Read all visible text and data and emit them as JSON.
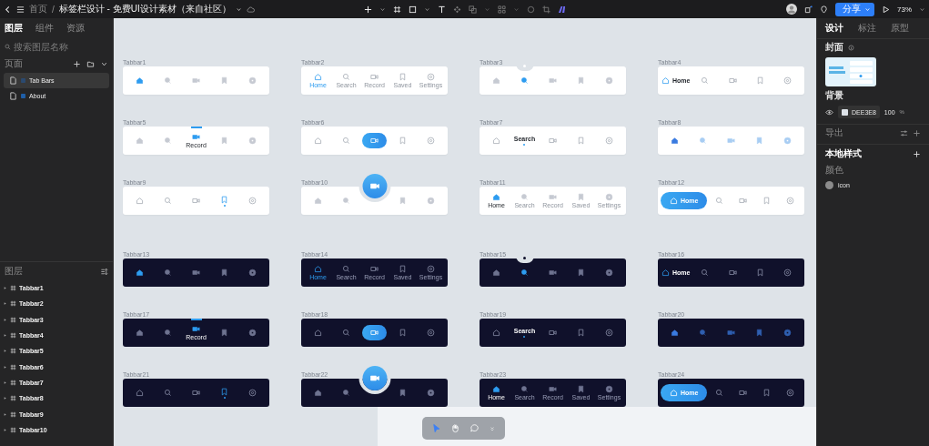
{
  "topbar": {
    "breadcrumb": "首页",
    "separator": "/",
    "title": "标签栏设计 - 免费UI设计素材（来自社区）",
    "share": "分享",
    "zoom": "73%"
  },
  "left_panel": {
    "tabs": [
      {
        "label": "图层",
        "selected": true
      },
      {
        "label": "组件",
        "selected": false
      },
      {
        "label": "资源",
        "selected": false
      }
    ],
    "search": {
      "placeholder": "搜索图层名称"
    },
    "pages_header": "页面",
    "pages": [
      {
        "name": "Tab Bars",
        "selected": true
      },
      {
        "name": "About",
        "selected": false
      }
    ],
    "layers_header": "图层",
    "layers": [
      {
        "name": "Tabbar1"
      },
      {
        "name": "Tabbar2"
      },
      {
        "name": "Tabbar3"
      },
      {
        "name": "Tabbar4"
      },
      {
        "name": "Tabbar5"
      },
      {
        "name": "Tabbar6"
      },
      {
        "name": "Tabbar7"
      },
      {
        "name": "Tabbar8"
      },
      {
        "name": "Tabbar9"
      },
      {
        "name": "Tabbar10"
      }
    ]
  },
  "canvas": {
    "tabbars": [
      {
        "title": "Tabbar1",
        "dark": false,
        "kind": "plain",
        "outline_icons": false,
        "items": [
          {
            "selected": true
          },
          {
            "selected": false
          },
          {
            "selected": false
          },
          {
            "selected": false
          },
          {
            "selected": false
          }
        ]
      },
      {
        "title": "Tabbar2",
        "dark": false,
        "kind": "labeled",
        "outline_icons": true,
        "items": [
          {
            "label": "Home",
            "selected": true
          },
          {
            "label": "Search",
            "selected": false
          },
          {
            "label": "Record",
            "selected": false
          },
          {
            "label": "Saved",
            "selected": false
          },
          {
            "label": "Settings",
            "selected": false
          }
        ]
      },
      {
        "title": "Tabbar3",
        "dark": false,
        "kind": "notch",
        "outline_icons": false,
        "items": [
          {
            "selected": false
          },
          {
            "selected": true
          },
          {
            "selected": false
          },
          {
            "selected": false
          },
          {
            "selected": false
          }
        ]
      },
      {
        "title": "Tabbar4",
        "dark": false,
        "kind": "inline-label",
        "outline_icons": true,
        "items": [
          {
            "label": "Home",
            "selected": true
          },
          {
            "selected": false
          },
          {
            "selected": false
          },
          {
            "selected": false
          },
          {
            "selected": false
          }
        ]
      },
      {
        "title": "Tabbar5",
        "dark": false,
        "kind": "top-bar",
        "outline_icons": false,
        "items": [
          {
            "selected": false
          },
          {
            "selected": false
          },
          {
            "label": "Record",
            "selected": true
          },
          {
            "selected": false
          },
          {
            "selected": false
          }
        ]
      },
      {
        "title": "Tabbar6",
        "dark": false,
        "kind": "pill-icon",
        "outline_icons": true,
        "items": [
          {
            "selected": false
          },
          {
            "selected": false
          },
          {
            "selected": true
          },
          {
            "selected": false
          },
          {
            "selected": false
          }
        ]
      },
      {
        "title": "Tabbar7",
        "dark": false,
        "kind": "text-dot",
        "outline_icons": true,
        "items": [
          {
            "selected": false
          },
          {
            "label": "Search",
            "selected": true
          },
          {
            "selected": false
          },
          {
            "selected": false
          },
          {
            "selected": false
          }
        ]
      },
      {
        "title": "Tabbar8",
        "dark": false,
        "kind": "gradient",
        "outline_icons": false,
        "items": [
          {
            "selected": true
          },
          {
            "selected": false
          },
          {
            "selected": false
          },
          {
            "selected": false
          },
          {
            "selected": false
          }
        ]
      },
      {
        "title": "Tabbar9",
        "dark": false,
        "kind": "outline",
        "outline_icons": true,
        "items": [
          {
            "selected": false
          },
          {
            "selected": false
          },
          {
            "selected": false
          },
          {
            "selected": true
          },
          {
            "selected": false
          }
        ]
      },
      {
        "title": "Tabbar10",
        "dark": false,
        "kind": "fab",
        "outline_icons": false,
        "items": [
          {
            "selected": false
          },
          {
            "selected": false
          },
          {
            "selected": true
          },
          {
            "selected": false
          },
          {
            "selected": false
          }
        ]
      },
      {
        "title": "Tabbar11",
        "dark": false,
        "kind": "labeled",
        "outline_icons": false,
        "items": [
          {
            "label": "Home",
            "selected": true
          },
          {
            "label": "Search",
            "selected": false
          },
          {
            "label": "Record",
            "selected": false
          },
          {
            "label": "Saved",
            "selected": false
          },
          {
            "label": "Settings",
            "selected": false
          }
        ]
      },
      {
        "title": "Tabbar12",
        "dark": false,
        "kind": "pill-label",
        "outline_icons": true,
        "items": [
          {
            "label": "Home",
            "selected": true
          },
          {
            "selected": false
          },
          {
            "selected": false
          },
          {
            "selected": false
          },
          {
            "selected": false
          }
        ]
      },
      {
        "title": "Tabbar13",
        "dark": true,
        "kind": "plain",
        "outline_icons": false,
        "items": [
          {
            "selected": true
          },
          {
            "selected": false
          },
          {
            "selected": false
          },
          {
            "selected": false
          },
          {
            "selected": false
          }
        ]
      },
      {
        "title": "Tabbar14",
        "dark": true,
        "kind": "labeled",
        "outline_icons": true,
        "items": [
          {
            "label": "Home",
            "selected": true
          },
          {
            "label": "Search",
            "selected": false
          },
          {
            "label": "Record",
            "selected": false
          },
          {
            "label": "Saved",
            "selected": false
          },
          {
            "label": "Settings",
            "selected": false
          }
        ]
      },
      {
        "title": "Tabbar15",
        "dark": true,
        "kind": "notch",
        "outline_icons": false,
        "items": [
          {
            "selected": false
          },
          {
            "selected": true
          },
          {
            "selected": false
          },
          {
            "selected": false
          },
          {
            "selected": false
          }
        ]
      },
      {
        "title": "Tabbar16",
        "dark": true,
        "kind": "inline-label",
        "outline_icons": true,
        "items": [
          {
            "label": "Home",
            "selected": true
          },
          {
            "selected": false
          },
          {
            "selected": false
          },
          {
            "selected": false
          },
          {
            "selected": false
          }
        ]
      },
      {
        "title": "Tabbar17",
        "dark": true,
        "kind": "top-bar",
        "outline_icons": false,
        "items": [
          {
            "selected": false
          },
          {
            "selected": false
          },
          {
            "label": "Record",
            "selected": true
          },
          {
            "selected": false
          },
          {
            "selected": false
          }
        ]
      },
      {
        "title": "Tabbar18",
        "dark": true,
        "kind": "pill-icon",
        "outline_icons": true,
        "items": [
          {
            "selected": false
          },
          {
            "selected": false
          },
          {
            "selected": true
          },
          {
            "selected": false
          },
          {
            "selected": false
          }
        ]
      },
      {
        "title": "Tabbar19",
        "dark": true,
        "kind": "text-dot",
        "outline_icons": true,
        "items": [
          {
            "selected": false
          },
          {
            "label": "Search",
            "selected": true
          },
          {
            "selected": false
          },
          {
            "selected": false
          },
          {
            "selected": false
          }
        ]
      },
      {
        "title": "Tabbar20",
        "dark": true,
        "kind": "gradient",
        "outline_icons": false,
        "items": [
          {
            "selected": true
          },
          {
            "selected": false
          },
          {
            "selected": false
          },
          {
            "selected": false
          },
          {
            "selected": false
          }
        ]
      },
      {
        "title": "Tabbar21",
        "dark": true,
        "kind": "outline",
        "outline_icons": true,
        "items": [
          {
            "selected": false
          },
          {
            "selected": false
          },
          {
            "selected": false
          },
          {
            "selected": true
          },
          {
            "selected": false
          }
        ]
      },
      {
        "title": "Tabbar22",
        "dark": true,
        "kind": "fab",
        "outline_icons": false,
        "items": [
          {
            "selected": false
          },
          {
            "selected": false
          },
          {
            "selected": true
          },
          {
            "selected": false
          },
          {
            "selected": false
          }
        ]
      },
      {
        "title": "Tabbar23",
        "dark": true,
        "kind": "labeled",
        "outline_icons": false,
        "items": [
          {
            "label": "Home",
            "selected": true
          },
          {
            "label": "Search",
            "selected": false
          },
          {
            "label": "Record",
            "selected": false
          },
          {
            "label": "Saved",
            "selected": false
          },
          {
            "label": "Settings",
            "selected": false
          }
        ]
      },
      {
        "title": "Tabbar24",
        "dark": true,
        "kind": "pill-label",
        "outline_icons": true,
        "items": [
          {
            "label": "Home",
            "selected": true
          },
          {
            "selected": false
          },
          {
            "selected": false
          },
          {
            "selected": false
          },
          {
            "selected": false
          }
        ]
      }
    ]
  },
  "right_panel": {
    "tabs": [
      {
        "label": "设计",
        "selected": true
      },
      {
        "label": "标注",
        "selected": false
      },
      {
        "label": "原型",
        "selected": false
      }
    ],
    "cover_label": "封面",
    "background_label": "背景",
    "background": {
      "hex": "DEE3E8",
      "opacity": "100",
      "unit": "%"
    },
    "export_label": "导出",
    "local_styles_label": "本地样式",
    "colors_label": "颜色",
    "styles": [
      {
        "name": "icon",
        "color": "#8c8c8c"
      }
    ]
  },
  "bottom_toolbar": {
    "tools": [
      {
        "selected": true
      },
      {
        "selected": false
      },
      {
        "selected": false
      }
    ]
  }
}
